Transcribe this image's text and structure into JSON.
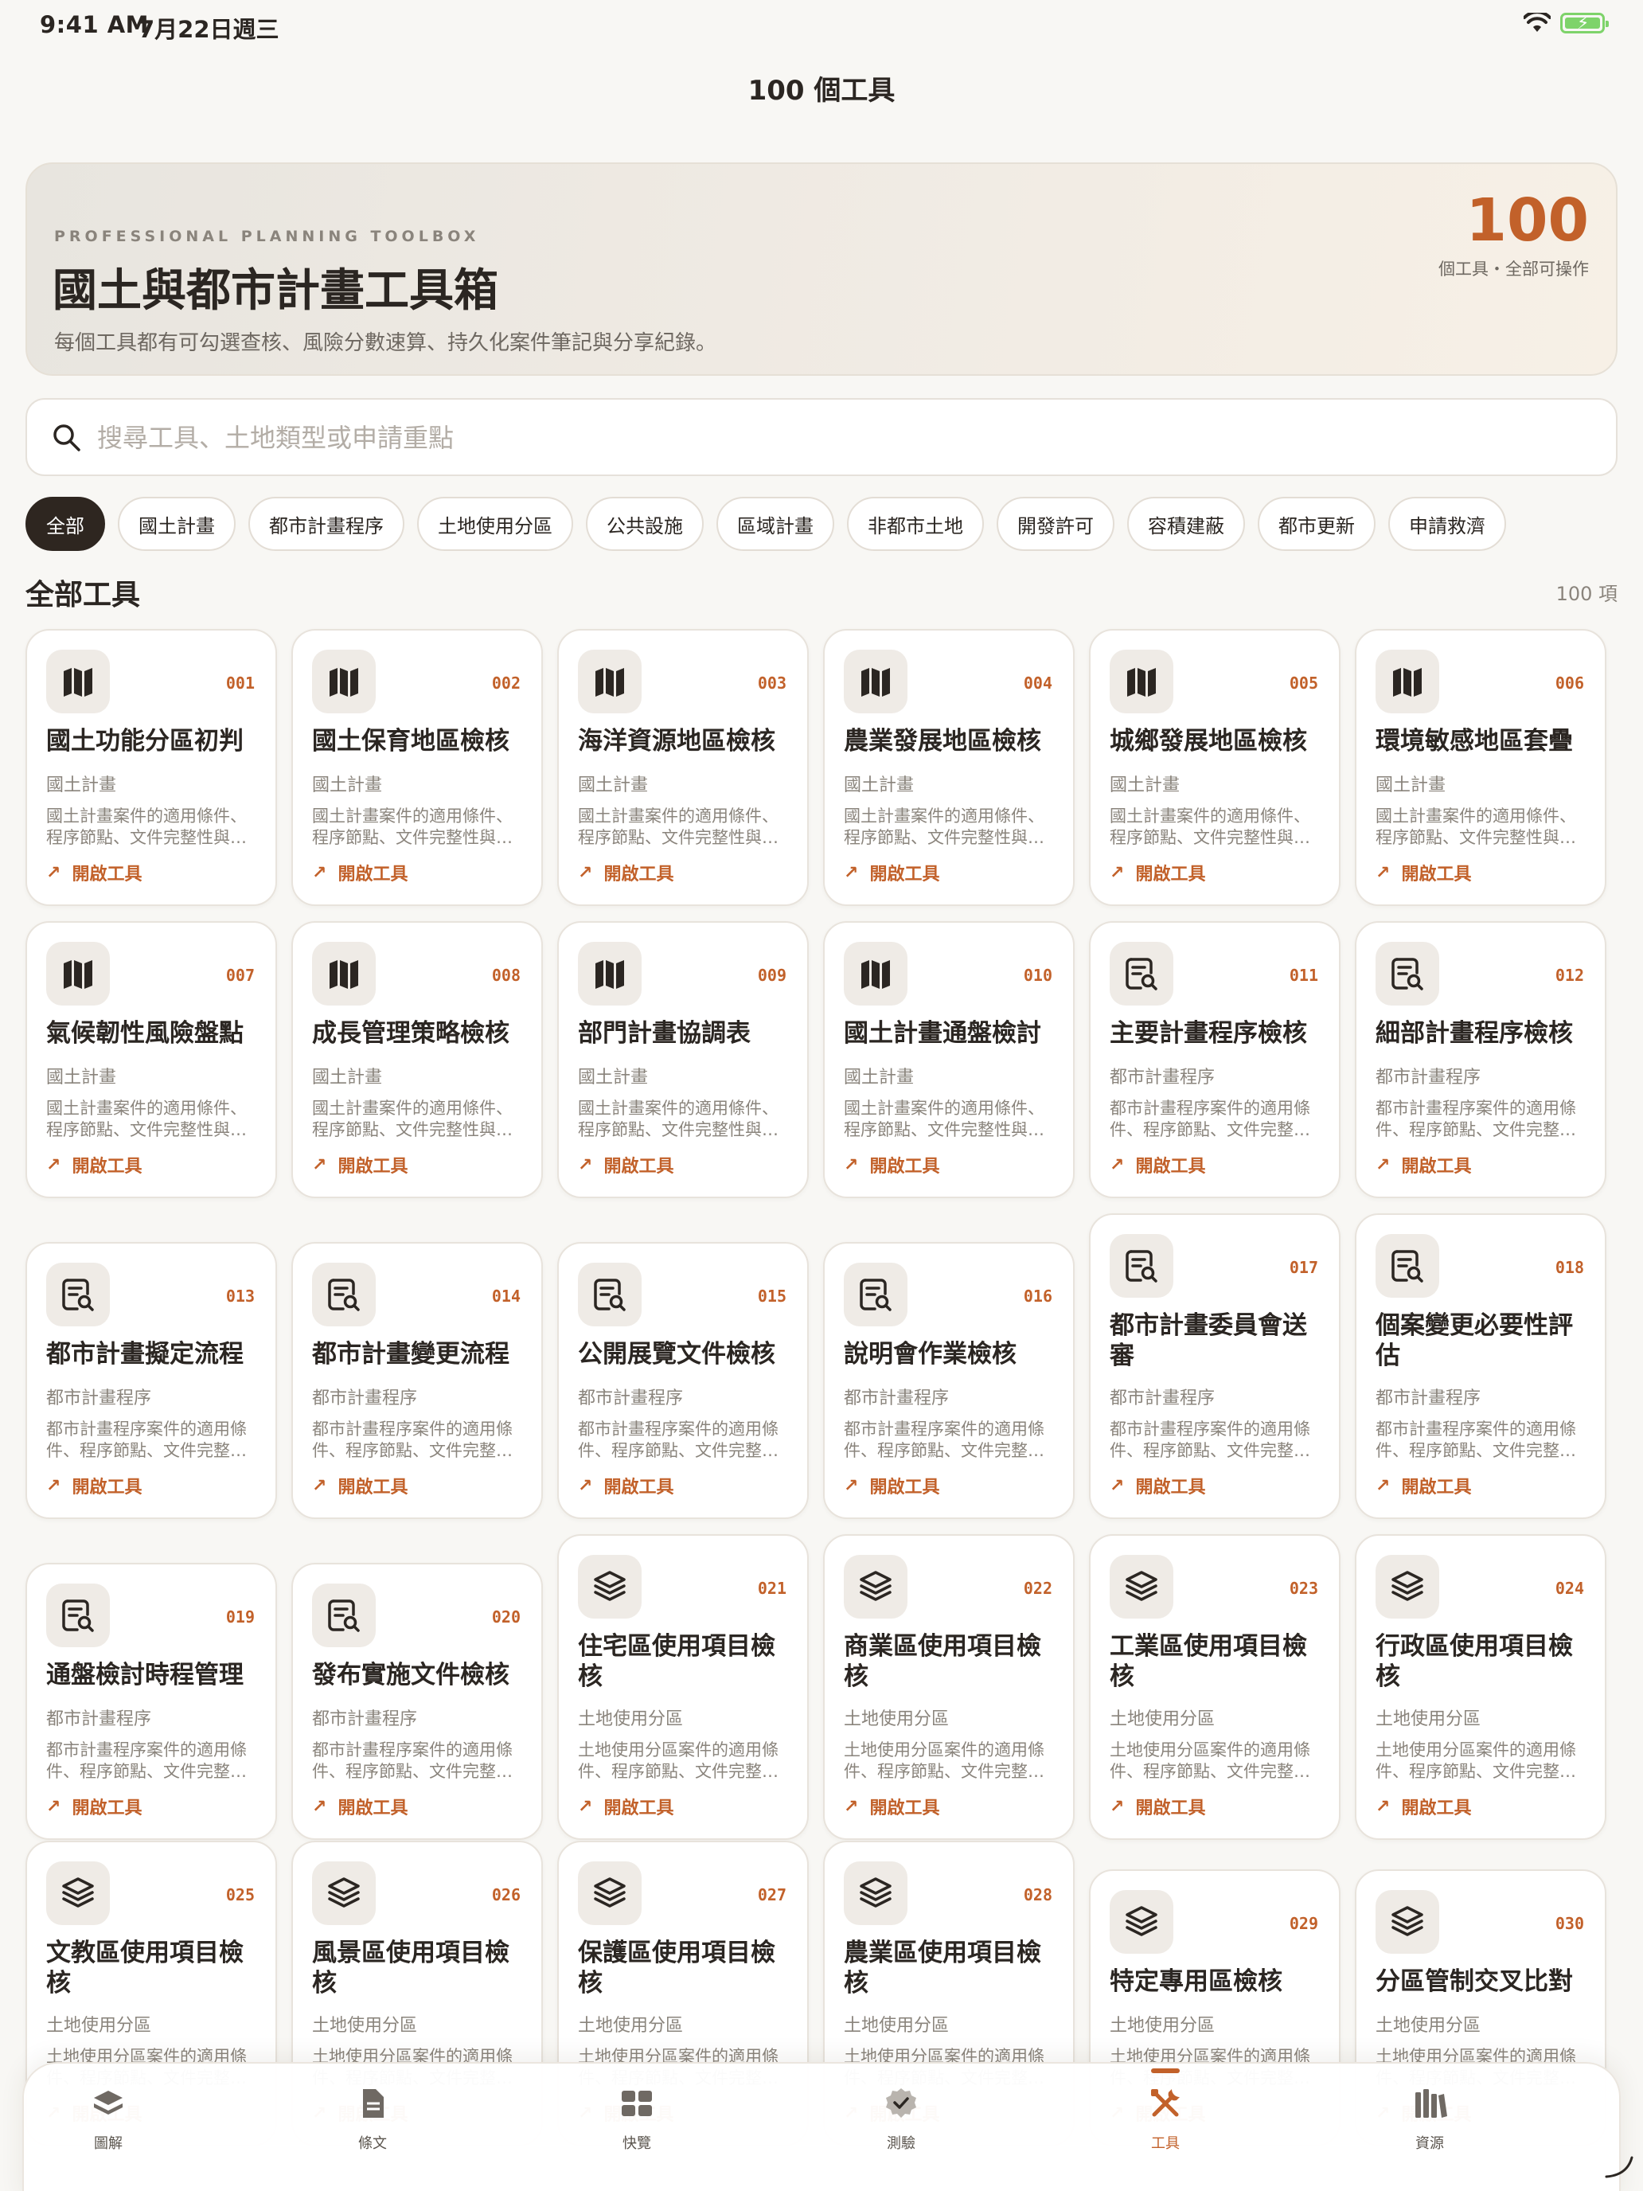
{
  "status_bar": {
    "time": "9:41 AM",
    "date": "7月22日週三"
  },
  "nav": {
    "title": "100 個工具"
  },
  "hero": {
    "kicker": "PROFESSIONAL PLANNING TOOLBOX",
    "title": "國土與都市計畫工具箱",
    "subtitle": "每個工具都有可勾選查核、風險分數速算、持久化案件筆記與分享紀錄。",
    "count": "100",
    "count_label": "個工具・全部可操作"
  },
  "search": {
    "placeholder": "搜尋工具、土地類型或申請重點"
  },
  "filters": [
    "全部",
    "國土計畫",
    "都市計畫程序",
    "土地使用分區",
    "公共設施",
    "區域計畫",
    "非都市土地",
    "開發許可",
    "容積建蔽",
    "都市更新",
    "申請救濟"
  ],
  "section": {
    "title": "全部工具",
    "count": "100 項"
  },
  "open_label": "開啟工具",
  "tools": [
    {
      "num": "001",
      "title": "國土功能分區初判",
      "category": "國土計畫",
      "desc": "國土計畫案件的適用條件、程序節點、文件完整性與…",
      "icon": "map-icon"
    },
    {
      "num": "002",
      "title": "國土保育地區檢核",
      "category": "國土計畫",
      "desc": "國土計畫案件的適用條件、程序節點、文件完整性與…",
      "icon": "map-icon"
    },
    {
      "num": "003",
      "title": "海洋資源地區檢核",
      "category": "國土計畫",
      "desc": "國土計畫案件的適用條件、程序節點、文件完整性與…",
      "icon": "map-icon"
    },
    {
      "num": "004",
      "title": "農業發展地區檢核",
      "category": "國土計畫",
      "desc": "國土計畫案件的適用條件、程序節點、文件完整性與…",
      "icon": "map-icon"
    },
    {
      "num": "005",
      "title": "城鄉發展地區檢核",
      "category": "國土計畫",
      "desc": "國土計畫案件的適用條件、程序節點、文件完整性與…",
      "icon": "map-icon"
    },
    {
      "num": "006",
      "title": "環境敏感地區套疊",
      "category": "國土計畫",
      "desc": "國土計畫案件的適用條件、程序節點、文件完整性與…",
      "icon": "map-icon"
    },
    {
      "num": "007",
      "title": "氣候韌性風險盤點",
      "category": "國土計畫",
      "desc": "國土計畫案件的適用條件、程序節點、文件完整性與…",
      "icon": "map-icon"
    },
    {
      "num": "008",
      "title": "成長管理策略檢核",
      "category": "國土計畫",
      "desc": "國土計畫案件的適用條件、程序節點、文件完整性與…",
      "icon": "map-icon"
    },
    {
      "num": "009",
      "title": "部門計畫協調表",
      "category": "國土計畫",
      "desc": "國土計畫案件的適用條件、程序節點、文件完整性與…",
      "icon": "map-icon"
    },
    {
      "num": "010",
      "title": "國土計畫通盤檢討",
      "category": "國土計畫",
      "desc": "國土計畫案件的適用條件、程序節點、文件完整性與…",
      "icon": "map-icon"
    },
    {
      "num": "011",
      "title": "主要計畫程序檢核",
      "category": "都市計畫程序",
      "desc": "都市計畫程序案件的適用條件、程序節點、文件完整…",
      "icon": "doc-search-icon"
    },
    {
      "num": "012",
      "title": "細部計畫程序檢核",
      "category": "都市計畫程序",
      "desc": "都市計畫程序案件的適用條件、程序節點、文件完整…",
      "icon": "doc-search-icon"
    },
    {
      "num": "013",
      "title": "都市計畫擬定流程",
      "category": "都市計畫程序",
      "desc": "都市計畫程序案件的適用條件、程序節點、文件完整…",
      "icon": "doc-search-icon"
    },
    {
      "num": "014",
      "title": "都市計畫變更流程",
      "category": "都市計畫程序",
      "desc": "都市計畫程序案件的適用條件、程序節點、文件完整…",
      "icon": "doc-search-icon"
    },
    {
      "num": "015",
      "title": "公開展覽文件檢核",
      "category": "都市計畫程序",
      "desc": "都市計畫程序案件的適用條件、程序節點、文件完整…",
      "icon": "doc-search-icon"
    },
    {
      "num": "016",
      "title": "說明會作業檢核",
      "category": "都市計畫程序",
      "desc": "都市計畫程序案件的適用條件、程序節點、文件完整…",
      "icon": "doc-search-icon"
    },
    {
      "num": "017",
      "title": "都市計畫委員會送審",
      "category": "都市計畫程序",
      "desc": "都市計畫程序案件的適用條件、程序節點、文件完整…",
      "icon": "doc-search-icon"
    },
    {
      "num": "018",
      "title": "個案變更必要性評估",
      "category": "都市計畫程序",
      "desc": "都市計畫程序案件的適用條件、程序節點、文件完整…",
      "icon": "doc-search-icon"
    },
    {
      "num": "019",
      "title": "通盤檢討時程管理",
      "category": "都市計畫程序",
      "desc": "都市計畫程序案件的適用條件、程序節點、文件完整…",
      "icon": "doc-search-icon"
    },
    {
      "num": "020",
      "title": "發布實施文件檢核",
      "category": "都市計畫程序",
      "desc": "都市計畫程序案件的適用條件、程序節點、文件完整…",
      "icon": "doc-search-icon"
    },
    {
      "num": "021",
      "title": "住宅區使用項目檢核",
      "category": "土地使用分區",
      "desc": "土地使用分區案件的適用條件、程序節點、文件完整…",
      "icon": "layers-icon"
    },
    {
      "num": "022",
      "title": "商業區使用項目檢核",
      "category": "土地使用分區",
      "desc": "土地使用分區案件的適用條件、程序節點、文件完整…",
      "icon": "layers-icon"
    },
    {
      "num": "023",
      "title": "工業區使用項目檢核",
      "category": "土地使用分區",
      "desc": "土地使用分區案件的適用條件、程序節點、文件完整…",
      "icon": "layers-icon"
    },
    {
      "num": "024",
      "title": "行政區使用項目檢核",
      "category": "土地使用分區",
      "desc": "土地使用分區案件的適用條件、程序節點、文件完整…",
      "icon": "layers-icon"
    },
    {
      "num": "025",
      "title": "文教區使用項目檢核",
      "category": "土地使用分區",
      "desc": "土地使用分區案件的適用條件、程序節點、文件完整…",
      "icon": "layers-icon"
    },
    {
      "num": "026",
      "title": "風景區使用項目檢核",
      "category": "土地使用分區",
      "desc": "土地使用分區案件的適用條件、程序節點、文件完整…",
      "icon": "layers-icon"
    },
    {
      "num": "027",
      "title": "保護區使用項目檢核",
      "category": "土地使用分區",
      "desc": "土地使用分區案件的適用條件、程序節點、文件完整…",
      "icon": "layers-icon"
    },
    {
      "num": "028",
      "title": "農業區使用項目檢核",
      "category": "土地使用分區",
      "desc": "土地使用分區案件的適用條件、程序節點、文件完整…",
      "icon": "layers-icon"
    },
    {
      "num": "029",
      "title": "特定專用區檢核",
      "category": "土地使用分區",
      "desc": "土地使用分區案件的適用條件、程序節點、文件完整…",
      "icon": "layers-icon"
    },
    {
      "num": "030",
      "title": "分區管制交叉比對",
      "category": "土地使用分區",
      "desc": "土地使用分區案件的適用條件、程序節點、文件完整…",
      "icon": "layers-icon"
    }
  ],
  "tabs": [
    {
      "label": "圖解",
      "icon": "stack-icon"
    },
    {
      "label": "條文",
      "icon": "document-icon"
    },
    {
      "label": "快覽",
      "icon": "grid-icon"
    },
    {
      "label": "測驗",
      "icon": "check-badge-icon"
    },
    {
      "label": "工具",
      "icon": "tools-icon",
      "active": true
    },
    {
      "label": "資源",
      "icon": "books-icon"
    }
  ],
  "colors": {
    "accent": "#c2612a",
    "dark_chip": "#2e2620",
    "background": "#f8f7f4"
  }
}
